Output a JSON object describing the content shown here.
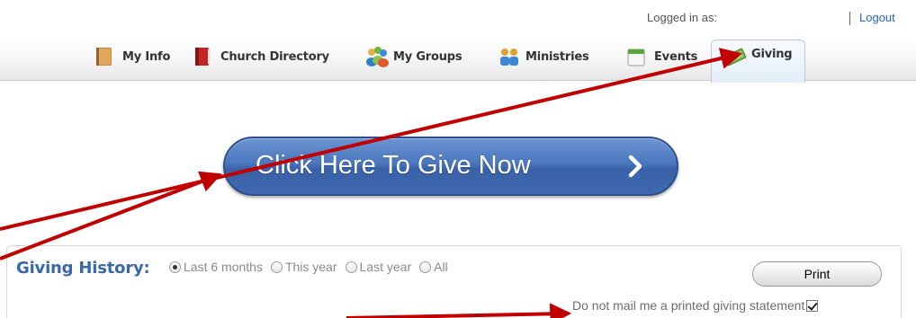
{
  "header": {
    "logged_in_label": "Logged in as:",
    "logged_in_user": "",
    "logout_label": "Logout"
  },
  "nav": {
    "tabs": [
      {
        "label": "My Info",
        "icon": "book-icon"
      },
      {
        "label": "Church Directory",
        "icon": "directory-book-icon"
      },
      {
        "label": "My Groups",
        "icon": "group-people-icon"
      },
      {
        "label": "Ministries",
        "icon": "ministries-people-icon"
      },
      {
        "label": "Events",
        "icon": "calendar-icon"
      },
      {
        "label": "Giving",
        "icon": "money-icon",
        "active": true
      }
    ]
  },
  "give": {
    "button_label": "Click Here To Give Now",
    "color": "#4a76bd"
  },
  "history": {
    "title": "Giving History:",
    "options": [
      {
        "label": "Last 6 months",
        "checked": true
      },
      {
        "label": "This year",
        "checked": false
      },
      {
        "label": "Last year",
        "checked": false
      },
      {
        "label": "All",
        "checked": false
      }
    ],
    "print_label": "Print",
    "mail_opt_label": "Do not mail me a printed giving statement",
    "mail_opt_checked": true
  },
  "annotation": {
    "arrow_color": "#c00000"
  }
}
